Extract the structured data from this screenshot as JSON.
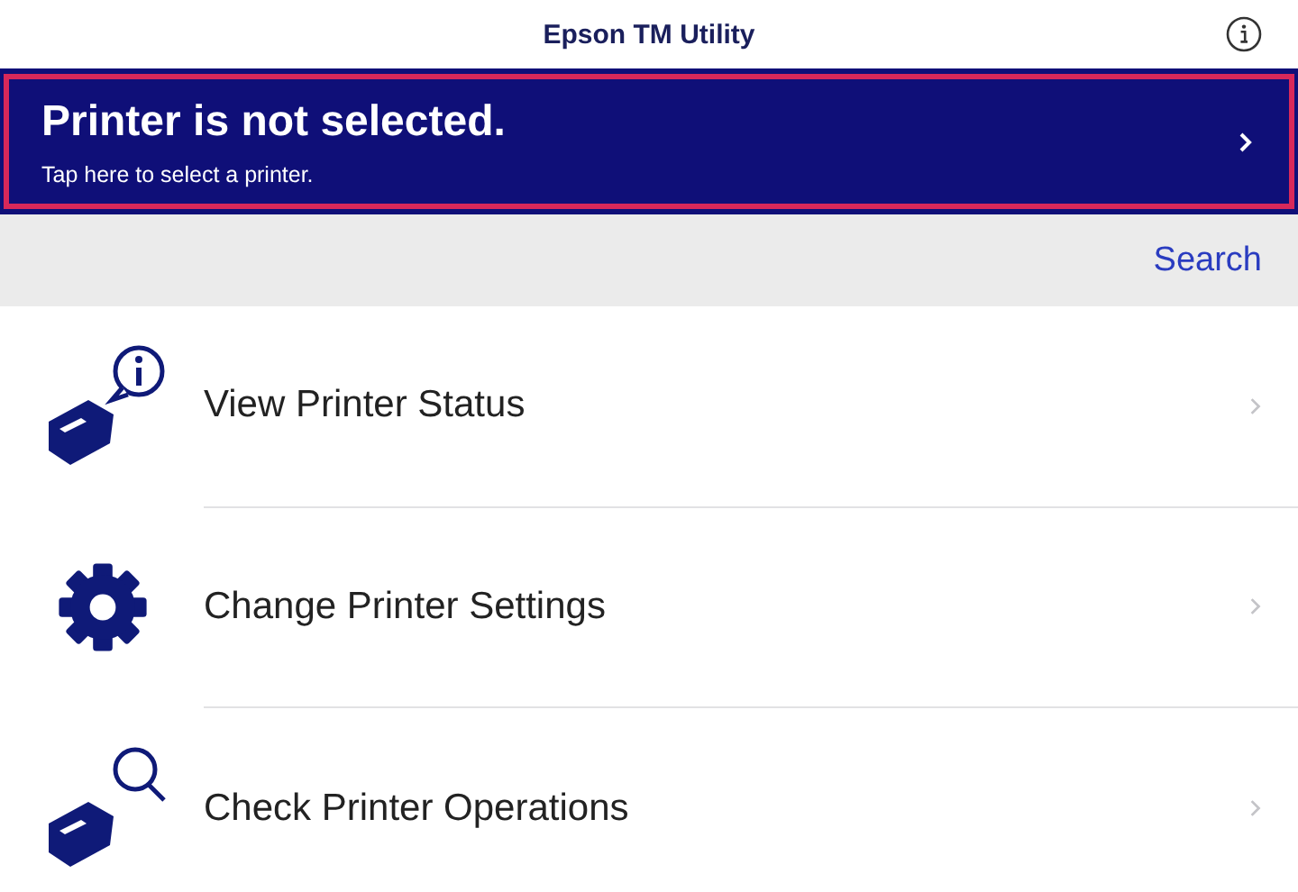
{
  "window": {
    "title": "Epson TM Utility"
  },
  "banner": {
    "title": "Printer is not selected.",
    "subtitle": "Tap here to select a printer."
  },
  "search": {
    "label": "Search"
  },
  "menu": [
    {
      "kind": "status",
      "label": "View Printer Status"
    },
    {
      "kind": "settings",
      "label": "Change Printer Settings"
    },
    {
      "kind": "operations",
      "label": "Check Printer Operations"
    }
  ]
}
